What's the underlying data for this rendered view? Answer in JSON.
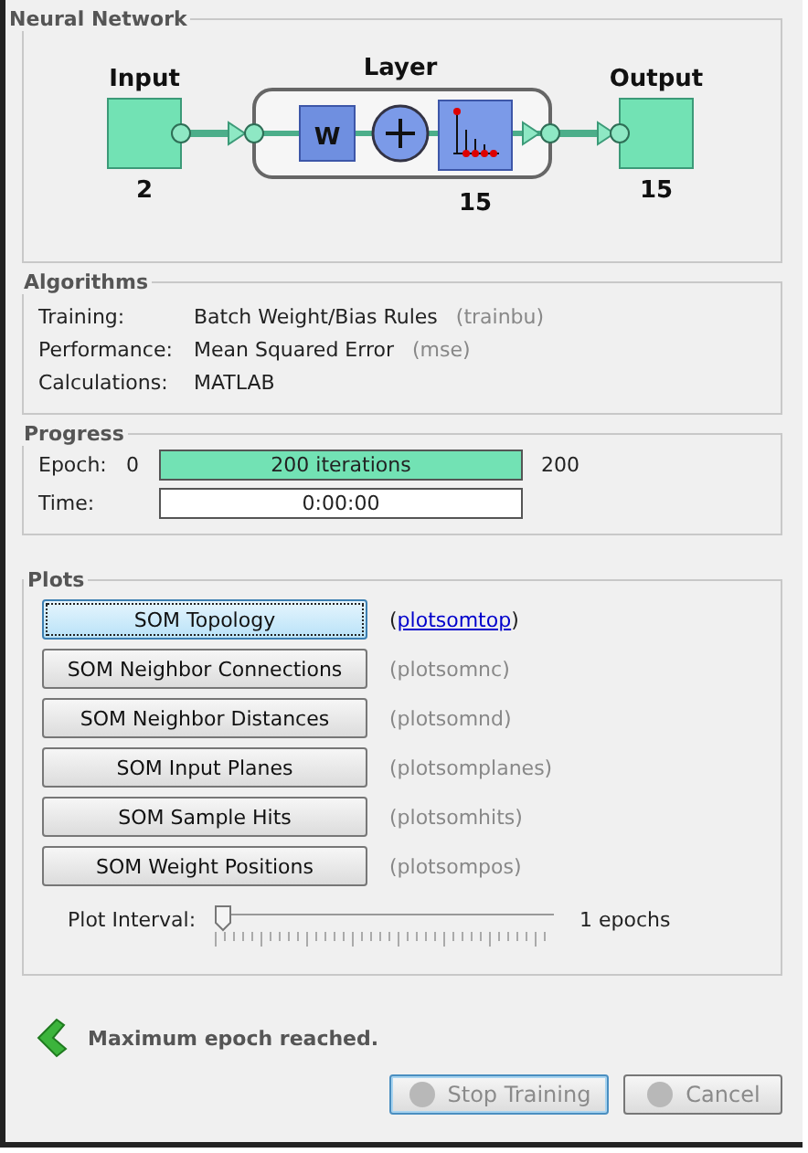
{
  "network": {
    "title": "Neural Network",
    "input": {
      "label": "Input",
      "size": "2"
    },
    "layer": {
      "label": "Layer",
      "weight": "W",
      "size": "15"
    },
    "output": {
      "label": "Output",
      "size": "15"
    }
  },
  "algorithms": {
    "title": "Algorithms",
    "rows": [
      {
        "label": "Training:",
        "value": "Batch Weight/Bias Rules",
        "code": "(trainbu)"
      },
      {
        "label": "Performance:",
        "value": "Mean Squared Error",
        "code": "(mse)"
      },
      {
        "label": "Calculations:",
        "value": "MATLAB"
      }
    ]
  },
  "progress": {
    "title": "Progress",
    "rows": [
      {
        "label": "Epoch:",
        "start": "0",
        "text": "200 iterations",
        "end": "200",
        "level": 1
      },
      {
        "label": "Time:",
        "text": "0:00:00"
      }
    ]
  },
  "plots": {
    "title": "Plots",
    "items": [
      {
        "label": "SOM Topology",
        "kind": "link",
        "before": "(",
        "code": "plotsomtop",
        "after": ")",
        "selected": true
      },
      {
        "label": "SOM Neighbor Connections",
        "kind": "text",
        "code": "(plotsomnc)",
        "selected": false
      },
      {
        "label": "SOM Neighbor Distances",
        "kind": "text",
        "code": "(plotsomnd)",
        "selected": false
      },
      {
        "label": "SOM Input Planes",
        "kind": "text",
        "code": "(plotsomplanes)",
        "selected": false
      },
      {
        "label": "SOM Sample Hits",
        "kind": "text",
        "code": "(plotsomhits)",
        "selected": false
      },
      {
        "label": "SOM Weight Positions",
        "kind": "text",
        "code": "(plotsompos)",
        "selected": false
      }
    ],
    "slider": {
      "label": "Plot Interval:",
      "level": 0,
      "reading": "1 epochs"
    }
  },
  "status": {
    "message": "Maximum epoch reached."
  },
  "buttons": [
    {
      "label": "Stop Training",
      "disabled": true,
      "default": true
    },
    {
      "label": "Cancel",
      "disabled": true,
      "default": false
    }
  ]
}
